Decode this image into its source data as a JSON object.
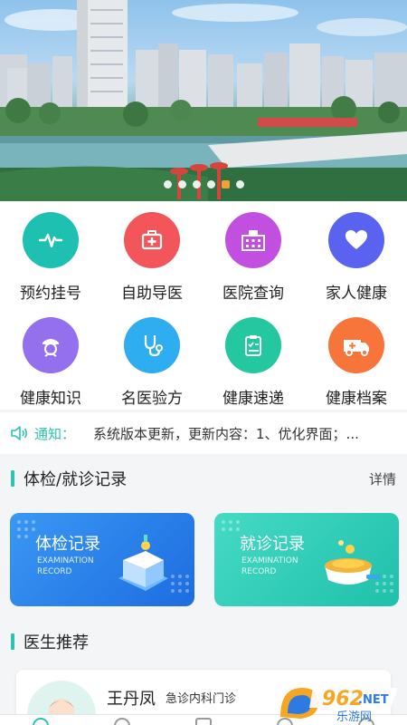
{
  "banner": {
    "dot_count": 6,
    "active_dot_index": 4
  },
  "grid": {
    "items": [
      {
        "label": "预约挂号",
        "icon": "pulse-icon",
        "color": "#1ec0b1"
      },
      {
        "label": "自助导医",
        "icon": "medkit-icon",
        "color": "#f2565a"
      },
      {
        "label": "医院查询",
        "icon": "hospital-icon",
        "color": "#c24fe0"
      },
      {
        "label": "家人健康",
        "icon": "heart-icon",
        "color": "#5a63f0"
      },
      {
        "label": "健康知识",
        "icon": "nurse-icon",
        "color": "#9470ee"
      },
      {
        "label": "名医验方",
        "icon": "stethoscope-icon",
        "color": "#2eaef0"
      },
      {
        "label": "健康速递",
        "icon": "clipboard-icon",
        "color": "#25c7a0"
      },
      {
        "label": "健康档案",
        "icon": "ambulance-icon",
        "color": "#f7743a"
      }
    ]
  },
  "notice": {
    "icon": "speaker-icon",
    "tag": "通知：",
    "text": "系统版本更新，更新内容：1、优化界面；..."
  },
  "records": {
    "title": "体检/就诊记录",
    "more": "详情",
    "cards": [
      {
        "title": "体检记录",
        "sub": "EXAMINATION RECORD",
        "color_from": "#2f8df0",
        "color_to": "#1f6fe0"
      },
      {
        "title": "就诊记录",
        "sub": "EXAMINATION RECORD",
        "color_from": "#3fd7c2",
        "color_to": "#22c2ae"
      }
    ]
  },
  "doctors": {
    "title": "医生推荐",
    "items": [
      {
        "name": "王丹凤",
        "dept": "急诊内科门诊"
      }
    ]
  },
  "watermark": {
    "brand": "962",
    "domain": ".NET",
    "cn": "乐游网"
  },
  "colors": {
    "accent": "#2cc4b0"
  }
}
